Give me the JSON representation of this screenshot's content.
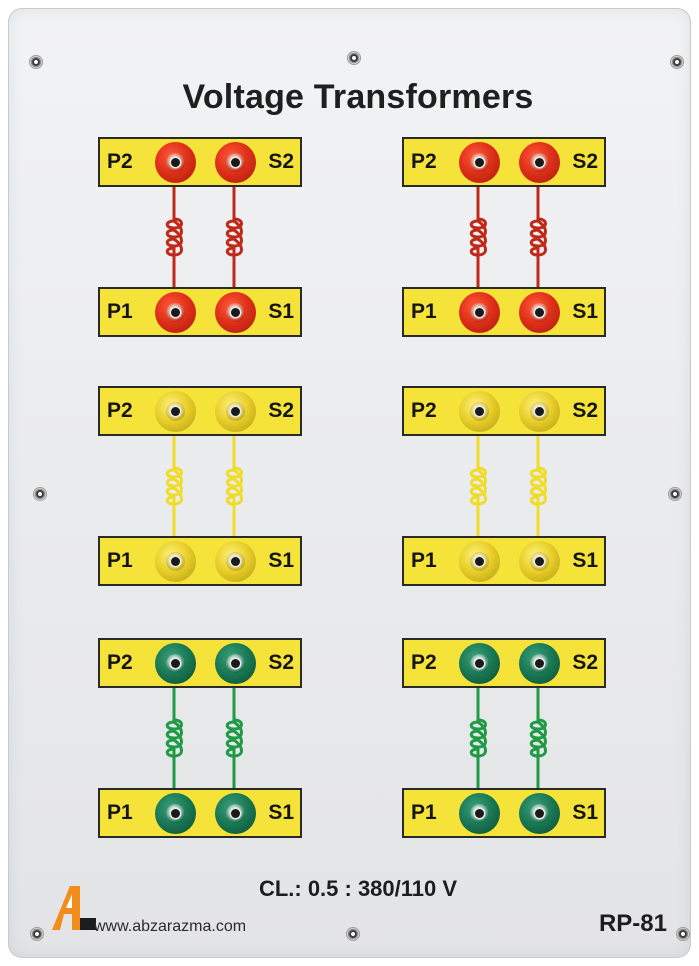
{
  "panel": {
    "title": "Voltage Transformers",
    "class_rating": "CL.: 0.5 : 380/110 V",
    "website": "www.abzarazma.com",
    "model": "RP-81",
    "logo_icon": "abzarazma-logo-icon"
  },
  "colors": {
    "terminal_box": "#f5e33a",
    "red_jack": "#e0301a",
    "yellow_jack": "#e8cf2a",
    "green_jack": "#1a7a55"
  },
  "labels": {
    "p2": "P2",
    "s2": "S2",
    "p1": "P1",
    "s1": "S1"
  },
  "transformers": [
    {
      "color": "red",
      "position": "left"
    },
    {
      "color": "red",
      "position": "right"
    },
    {
      "color": "yellow",
      "position": "left"
    },
    {
      "color": "yellow",
      "position": "right"
    },
    {
      "color": "green",
      "position": "left"
    },
    {
      "color": "green",
      "position": "right"
    }
  ]
}
